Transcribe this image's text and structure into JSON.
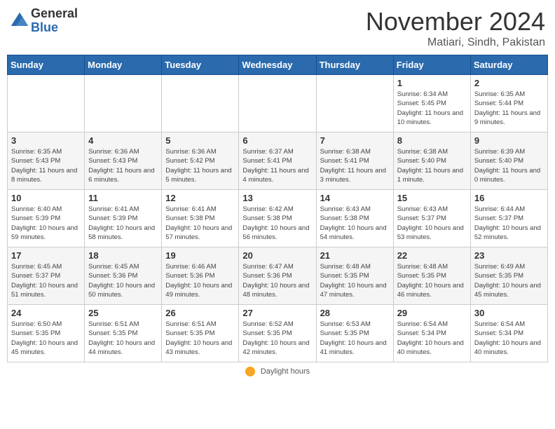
{
  "header": {
    "logo_general": "General",
    "logo_blue": "Blue",
    "month_title": "November 2024",
    "location": "Matiari, Sindh, Pakistan"
  },
  "weekdays": [
    "Sunday",
    "Monday",
    "Tuesday",
    "Wednesday",
    "Thursday",
    "Friday",
    "Saturday"
  ],
  "legend": {
    "label": "Daylight hours"
  },
  "weeks": [
    {
      "days": [
        {
          "num": "",
          "info": ""
        },
        {
          "num": "",
          "info": ""
        },
        {
          "num": "",
          "info": ""
        },
        {
          "num": "",
          "info": ""
        },
        {
          "num": "",
          "info": ""
        },
        {
          "num": "1",
          "info": "Sunrise: 6:34 AM\nSunset: 5:45 PM\nDaylight: 11 hours and 10 minutes."
        },
        {
          "num": "2",
          "info": "Sunrise: 6:35 AM\nSunset: 5:44 PM\nDaylight: 11 hours and 9 minutes."
        }
      ]
    },
    {
      "days": [
        {
          "num": "3",
          "info": "Sunrise: 6:35 AM\nSunset: 5:43 PM\nDaylight: 11 hours and 8 minutes."
        },
        {
          "num": "4",
          "info": "Sunrise: 6:36 AM\nSunset: 5:43 PM\nDaylight: 11 hours and 6 minutes."
        },
        {
          "num": "5",
          "info": "Sunrise: 6:36 AM\nSunset: 5:42 PM\nDaylight: 11 hours and 5 minutes."
        },
        {
          "num": "6",
          "info": "Sunrise: 6:37 AM\nSunset: 5:41 PM\nDaylight: 11 hours and 4 minutes."
        },
        {
          "num": "7",
          "info": "Sunrise: 6:38 AM\nSunset: 5:41 PM\nDaylight: 11 hours and 3 minutes."
        },
        {
          "num": "8",
          "info": "Sunrise: 6:38 AM\nSunset: 5:40 PM\nDaylight: 11 hours and 1 minute."
        },
        {
          "num": "9",
          "info": "Sunrise: 6:39 AM\nSunset: 5:40 PM\nDaylight: 11 hours and 0 minutes."
        }
      ]
    },
    {
      "days": [
        {
          "num": "10",
          "info": "Sunrise: 6:40 AM\nSunset: 5:39 PM\nDaylight: 10 hours and 59 minutes."
        },
        {
          "num": "11",
          "info": "Sunrise: 6:41 AM\nSunset: 5:39 PM\nDaylight: 10 hours and 58 minutes."
        },
        {
          "num": "12",
          "info": "Sunrise: 6:41 AM\nSunset: 5:38 PM\nDaylight: 10 hours and 57 minutes."
        },
        {
          "num": "13",
          "info": "Sunrise: 6:42 AM\nSunset: 5:38 PM\nDaylight: 10 hours and 56 minutes."
        },
        {
          "num": "14",
          "info": "Sunrise: 6:43 AM\nSunset: 5:38 PM\nDaylight: 10 hours and 54 minutes."
        },
        {
          "num": "15",
          "info": "Sunrise: 6:43 AM\nSunset: 5:37 PM\nDaylight: 10 hours and 53 minutes."
        },
        {
          "num": "16",
          "info": "Sunrise: 6:44 AM\nSunset: 5:37 PM\nDaylight: 10 hours and 52 minutes."
        }
      ]
    },
    {
      "days": [
        {
          "num": "17",
          "info": "Sunrise: 6:45 AM\nSunset: 5:37 PM\nDaylight: 10 hours and 51 minutes."
        },
        {
          "num": "18",
          "info": "Sunrise: 6:45 AM\nSunset: 5:36 PM\nDaylight: 10 hours and 50 minutes."
        },
        {
          "num": "19",
          "info": "Sunrise: 6:46 AM\nSunset: 5:36 PM\nDaylight: 10 hours and 49 minutes."
        },
        {
          "num": "20",
          "info": "Sunrise: 6:47 AM\nSunset: 5:36 PM\nDaylight: 10 hours and 48 minutes."
        },
        {
          "num": "21",
          "info": "Sunrise: 6:48 AM\nSunset: 5:35 PM\nDaylight: 10 hours and 47 minutes."
        },
        {
          "num": "22",
          "info": "Sunrise: 6:48 AM\nSunset: 5:35 PM\nDaylight: 10 hours and 46 minutes."
        },
        {
          "num": "23",
          "info": "Sunrise: 6:49 AM\nSunset: 5:35 PM\nDaylight: 10 hours and 45 minutes."
        }
      ]
    },
    {
      "days": [
        {
          "num": "24",
          "info": "Sunrise: 6:50 AM\nSunset: 5:35 PM\nDaylight: 10 hours and 45 minutes."
        },
        {
          "num": "25",
          "info": "Sunrise: 6:51 AM\nSunset: 5:35 PM\nDaylight: 10 hours and 44 minutes."
        },
        {
          "num": "26",
          "info": "Sunrise: 6:51 AM\nSunset: 5:35 PM\nDaylight: 10 hours and 43 minutes."
        },
        {
          "num": "27",
          "info": "Sunrise: 6:52 AM\nSunset: 5:35 PM\nDaylight: 10 hours and 42 minutes."
        },
        {
          "num": "28",
          "info": "Sunrise: 6:53 AM\nSunset: 5:35 PM\nDaylight: 10 hours and 41 minutes."
        },
        {
          "num": "29",
          "info": "Sunrise: 6:54 AM\nSunset: 5:34 PM\nDaylight: 10 hours and 40 minutes."
        },
        {
          "num": "30",
          "info": "Sunrise: 6:54 AM\nSunset: 5:34 PM\nDaylight: 10 hours and 40 minutes."
        }
      ]
    }
  ]
}
